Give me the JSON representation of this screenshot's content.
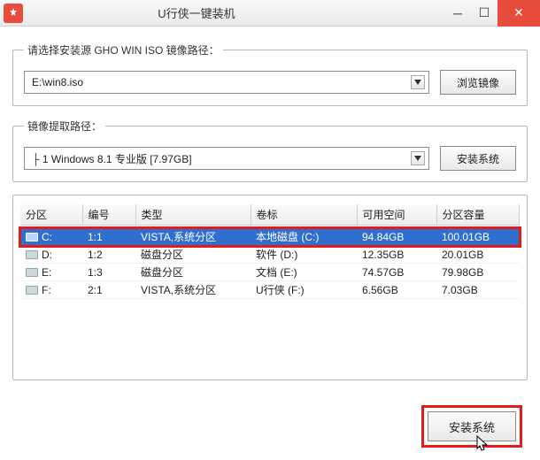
{
  "title": "U行侠一键装机",
  "group1": {
    "legend": "请选择安装源 GHO WIN ISO 镜像路径：",
    "value": "E:\\win8.iso",
    "browse": "浏览镜像"
  },
  "group2": {
    "legend": "镜像提取路径：",
    "value": "├ 1 Windows 8.1 专业版 [7.97GB]",
    "install": "安装系统"
  },
  "table": {
    "headers": [
      "分区",
      "编号",
      "类型",
      "卷标",
      "可用空间",
      "分区容量"
    ],
    "rows": [
      {
        "drive": "C:",
        "num": "1:1",
        "type": "VISTA,系统分区",
        "label": "本地磁盘 (C:)",
        "free": "94.84GB",
        "total": "100.01GB",
        "selected": true
      },
      {
        "drive": "D:",
        "num": "1:2",
        "type": "磁盘分区",
        "label": "软件 (D:)",
        "free": "12.35GB",
        "total": "20.01GB"
      },
      {
        "drive": "E:",
        "num": "1:3",
        "type": "磁盘分区",
        "label": "文档 (E:)",
        "free": "74.57GB",
        "total": "79.98GB"
      },
      {
        "drive": "F:",
        "num": "2:1",
        "type": "VISTA,系统分区",
        "label": "U行侠 (F:)",
        "free": "6.56GB",
        "total": "7.03GB"
      }
    ]
  },
  "footer": {
    "install": "安装系统"
  }
}
